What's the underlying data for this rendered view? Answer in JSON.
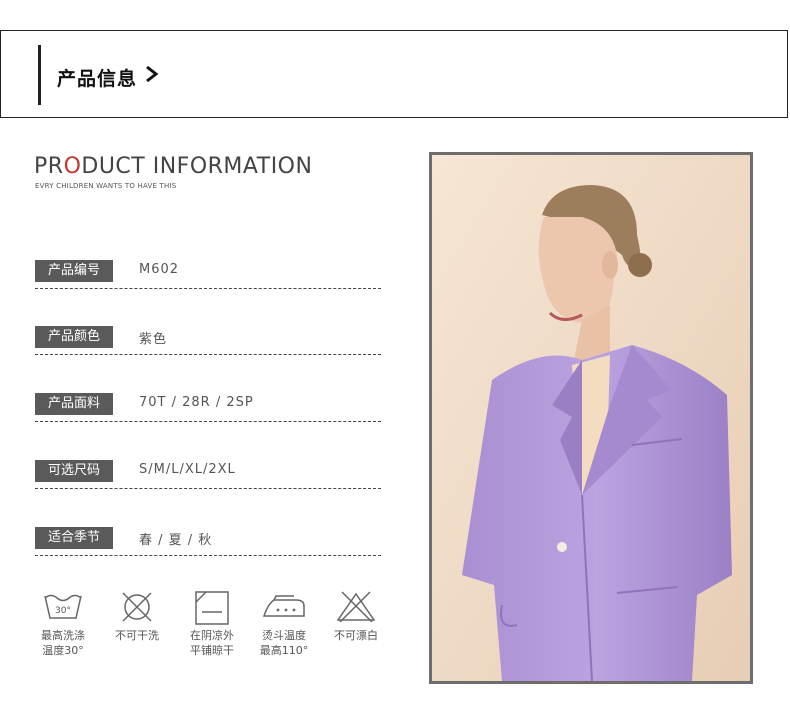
{
  "header": {
    "title": "产品信息"
  },
  "brand": {
    "pre": "PR",
    "o": "O",
    "post": "DUCT  INFORMATION",
    "subtitle": "EVRY CHILDREN WANTS TO HAVE THIS"
  },
  "specs": [
    {
      "label": "产品编号",
      "value": "M602"
    },
    {
      "label": "产品颜色",
      "value": "紫色"
    },
    {
      "label": "产品面料",
      "value": "70T / 28R / 2SP"
    },
    {
      "label": "可选尺码",
      "value": "S/M/L/XL/2XL"
    },
    {
      "label": "适合季节",
      "value": "春 / 夏 / 秋"
    }
  ],
  "care": [
    {
      "icon": "wash-30-icon",
      "line1": "最高洗涤",
      "line2": "温度30°",
      "badge": "30°"
    },
    {
      "icon": "no-dry-clean-icon",
      "line1": "不可干洗",
      "line2": ""
    },
    {
      "icon": "dry-flat-shade-icon",
      "line1": "在阴凉外",
      "line2": "平铺晾干"
    },
    {
      "icon": "iron-icon",
      "line1": "烫斗温度",
      "line2": "最高110°"
    },
    {
      "icon": "no-bleach-icon",
      "line1": "不可漂白",
      "line2": ""
    }
  ],
  "colors": {
    "tag_bg": "#5a5a5a",
    "accent": "#c0392b",
    "suit": "#b39ad8"
  }
}
